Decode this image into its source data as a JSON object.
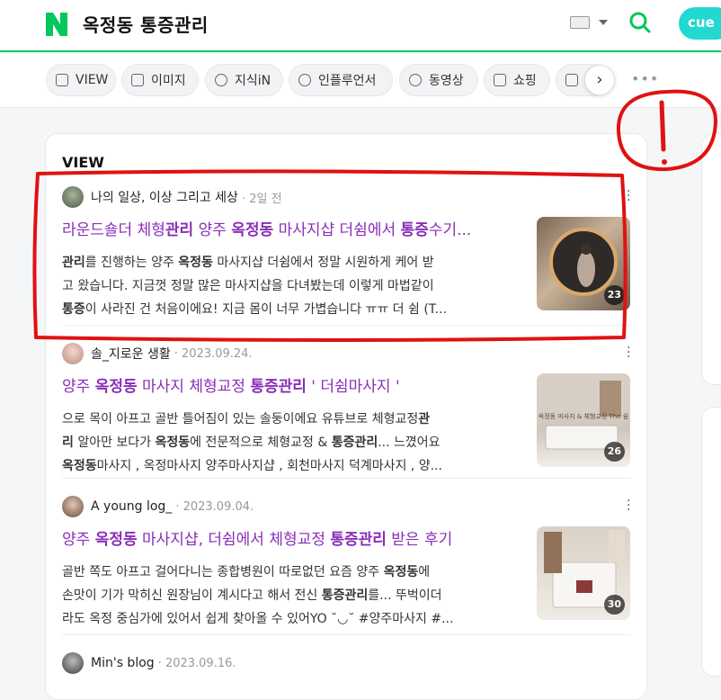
{
  "header": {
    "query": "옥정동 통증관리",
    "cue_label": "cue"
  },
  "tabs": [
    {
      "label": "VIEW"
    },
    {
      "label": "이미지"
    },
    {
      "label": "지식iN"
    },
    {
      "label": "인플루언서"
    },
    {
      "label": "동영상"
    },
    {
      "label": "쇼핑"
    },
    {
      "label": ""
    }
  ],
  "section": {
    "title": "VIEW"
  },
  "items": [
    {
      "author": "나의 일상, 이상 그리고 세상",
      "date": "2일 전",
      "title_parts": [
        "라운드숄더 체형",
        "관리",
        " 양주 ",
        "옥정동",
        " 마사지샵 더쉼에서 ",
        "통증",
        "수기..."
      ],
      "desc_lines": [
        [
          "",
          "관리",
          "를 진행하는 양주 ",
          "옥정동",
          " 마사지샵 더쉼에서 정말 시원하게 케어 받"
        ],
        [
          "고 왔습니다. 지금껏 정말 많은 마사지샵을 다녀봤는데 이렇게 마법같이"
        ],
        [
          "",
          "통증",
          "이 사라진 건 처음이에요! 지금 몸이 너무 가볍습니다 ㅠㅠ 더 쉼 (T..."
        ]
      ],
      "image_count": "23"
    },
    {
      "author": "솔_지로운 생활",
      "date": "2023.09.24.",
      "title_parts": [
        "양주 ",
        "옥정동",
        " 마사지 체형교정 ",
        "통증관리",
        " ' 더쉼마사지 '"
      ],
      "desc_lines": [
        [
          "으로 목이 아프고 골반 틀어짐이 있는 솔둥이에요 유튜브로 체형교정",
          "관"
        ],
        [
          "",
          "리",
          " 알아만 보다가 ",
          "옥정동",
          "에 전문적으로 체형교정 & ",
          "통증관리",
          "... 느꼈어요"
        ],
        [
          "",
          "옥정동",
          "마사지 , 옥정마사지 양주마사지샵 , 회천마사지 덕계마사지 , 양..."
        ]
      ],
      "thumb_caption": "옥정동 마사지 & 체형교정 The 쉼",
      "image_count": "26"
    },
    {
      "author": "A young log_",
      "date": "2023.09.04.",
      "title_parts": [
        "양주 ",
        "옥정동",
        " 마사지샵, 더쉼에서 체형교정 ",
        "통증관리",
        " 받은 후기"
      ],
      "desc_lines": [
        [
          "골반 쪽도 아프고 걸어다니는 종합병원이 따로없던 요즘 양주 ",
          "옥정동",
          "에"
        ],
        [
          "손맛이 기가 막히신 원장님이 계시다고 해서 전신 ",
          "통증관리",
          "를... 뚜벅이더"
        ],
        [
          "라도 옥정 중심가에 있어서 쉽게 찾아올 수 있어YO ˘◡˘ #양주마사지 #..."
        ]
      ],
      "image_count": "30"
    },
    {
      "author": "Min's blog",
      "date": "2023.09.16."
    }
  ]
}
